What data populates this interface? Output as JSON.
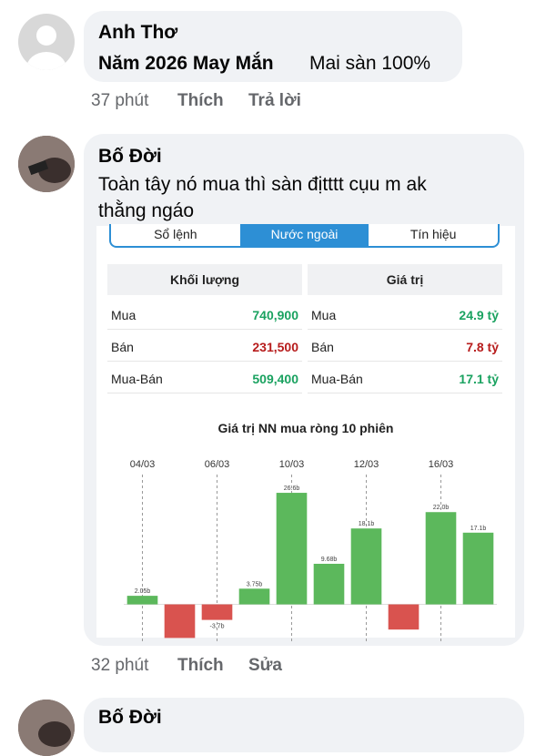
{
  "comments": [
    {
      "author": "Anh Thơ",
      "text_bold": "Năm 2026 May Mắn",
      "text": "Mai sàn 100%",
      "time": "37 phút",
      "actions": [
        "Thích",
        "Trả lời"
      ]
    },
    {
      "author": "Bố Đời",
      "text_line1": "Toàn tây nó mua thì sàn địtttt cụu m ak",
      "text_line2": "thằng ngáo",
      "time": "32 phút",
      "actions": [
        "Thích",
        "Sửa"
      ]
    },
    {
      "author": "Bố Đời"
    }
  ],
  "embedded": {
    "tabs": [
      "Sổ lệnh",
      "Nước ngoài",
      "Tín hiệu"
    ],
    "active_tab": "Nước ngoài",
    "volume_header": "Khối lượng",
    "value_header": "Giá trị",
    "volume_rows": [
      {
        "label": "Mua",
        "value": "740,900",
        "color": "#1aa260"
      },
      {
        "label": "Bán",
        "value": "231,500",
        "color": "#b71c1c"
      },
      {
        "label": "Mua-Bán",
        "value": "509,400",
        "color": "#1aa260"
      }
    ],
    "value_rows": [
      {
        "label": "Mua",
        "value": "24.9 tỷ",
        "color": "#1aa260"
      },
      {
        "label": "Bán",
        "value": "7.8 tỷ",
        "color": "#b71c1c"
      },
      {
        "label": "Mua-Bán",
        "value": "17.1 tỷ",
        "color": "#1aa260"
      }
    ],
    "chart_title": "Giá trị NN mua ròng 10 phiên"
  },
  "chart_data": {
    "type": "bar",
    "title": "Giá trị NN mua ròng 10 phiên",
    "x_tick_labels": [
      "04/03",
      "06/03",
      "10/03",
      "12/03",
      "16/03"
    ],
    "values": [
      2.05,
      -8.0,
      -3.7,
      3.75,
      26.6,
      9.68,
      18.1,
      -6.0,
      22.0,
      17.1
    ],
    "value_labels": [
      "2.05b",
      "",
      "-3.7b",
      "3.75b",
      "26.6b",
      "9.68b",
      "18.1b",
      "",
      "22.0b",
      "17.1b"
    ],
    "colors": {
      "positive": "#5cb85c",
      "negative": "#d9534f"
    },
    "ylim": [
      -9,
      29
    ]
  }
}
